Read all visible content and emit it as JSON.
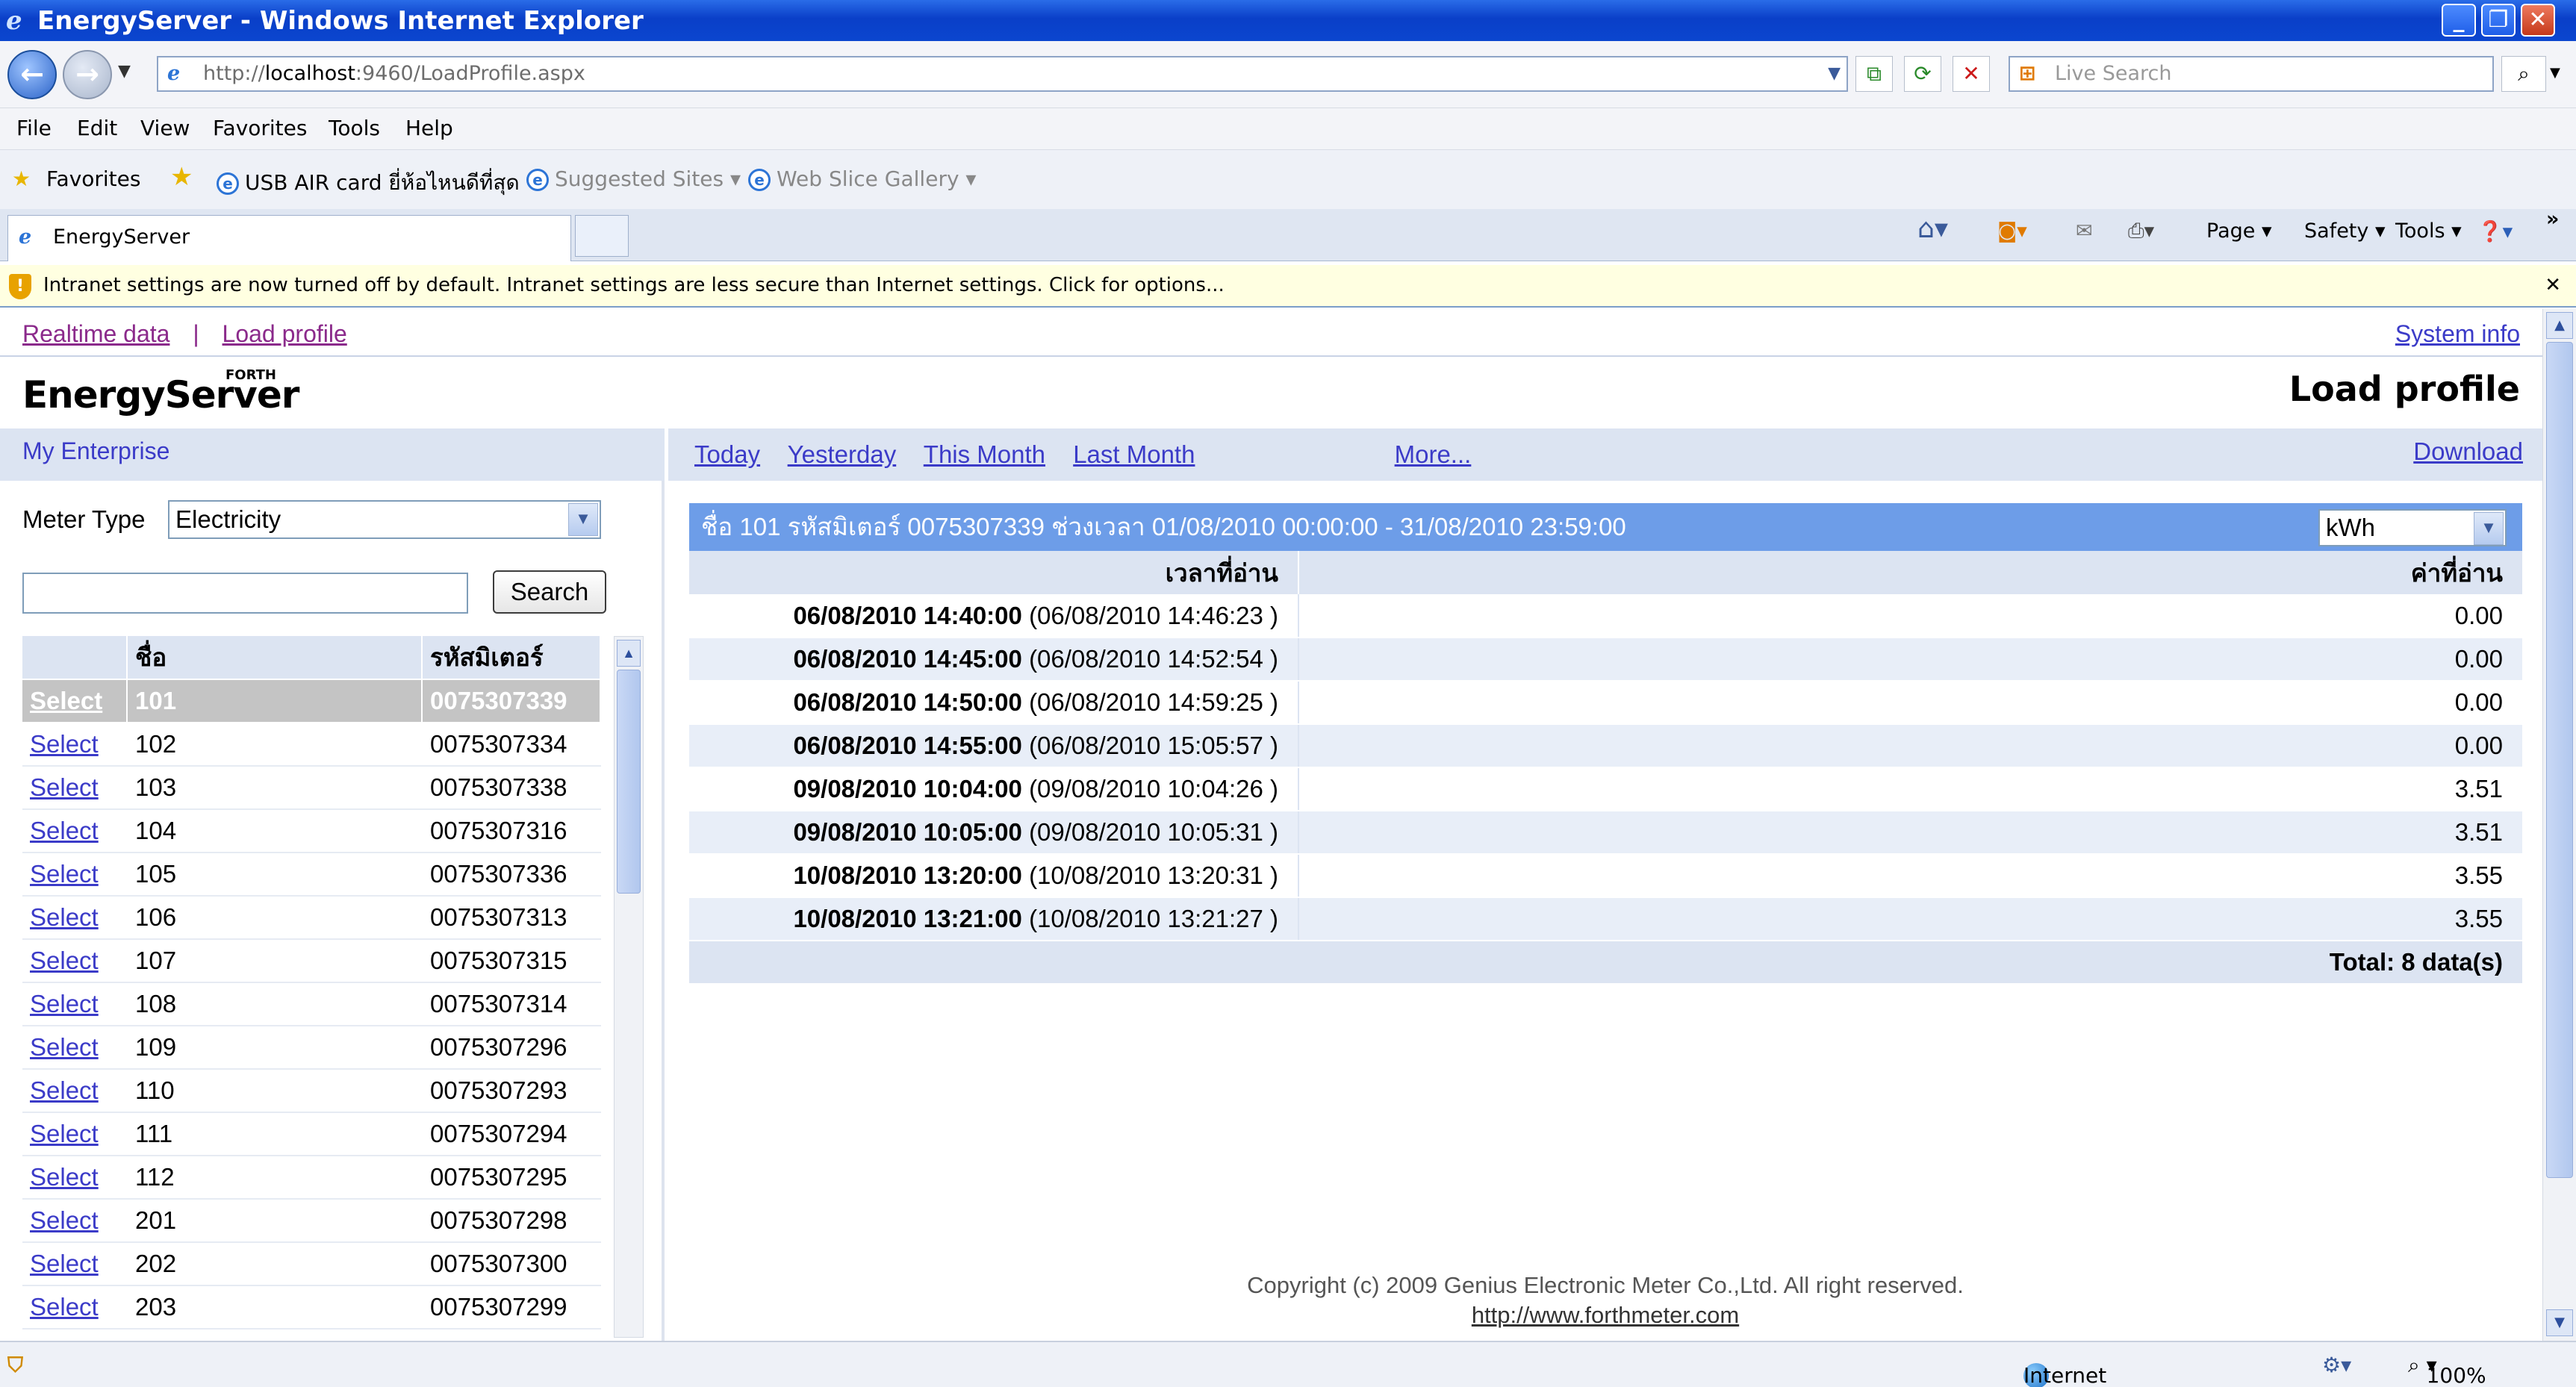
{
  "window": {
    "title": "EnergyServer - Windows Internet Explorer",
    "min": "_",
    "max": "❐",
    "close": "✕"
  },
  "address": {
    "prefix": "http://",
    "host": "localhost",
    "path": ":9460/LoadProfile.aspx",
    "search_placeholder": "Live Search"
  },
  "menu": [
    "File",
    "Edit",
    "View",
    "Favorites",
    "Tools",
    "Help"
  ],
  "favorites": {
    "label": "Favorites",
    "items": [
      "USB AIR card ยี่ห้อไหนดีที่สุด",
      "Suggested Sites ▾",
      "Web Slice Gallery ▾"
    ]
  },
  "tab": {
    "title": "EnergyServer"
  },
  "commands": [
    "Page ▾",
    "Safety ▾",
    "Tools ▾"
  ],
  "infobar": {
    "text": "Intranet settings are now turned off by default. Intranet settings are less secure than Internet settings. Click for options...",
    "close": "✕"
  },
  "nav": {
    "realtime": "Realtime data",
    "sep": "|",
    "load": "Load profile",
    "sysinfo": "System info"
  },
  "logo": {
    "main": "EnergyServer",
    "small": "FORTH"
  },
  "page_title": "Load profile",
  "left": {
    "enterprise": "My Enterprise",
    "meter_type_label": "Meter Type",
    "meter_type_value": "Electricity",
    "search_button": "Search",
    "table": {
      "headers": [
        "",
        "ชื่อ",
        "รหัสมิเตอร์"
      ],
      "select_label": "Select",
      "rows": [
        [
          "Select",
          "101",
          "0075307339"
        ],
        [
          "Select",
          "102",
          "0075307334"
        ],
        [
          "Select",
          "103",
          "0075307338"
        ],
        [
          "Select",
          "104",
          "0075307316"
        ],
        [
          "Select",
          "105",
          "0075307336"
        ],
        [
          "Select",
          "106",
          "0075307313"
        ],
        [
          "Select",
          "107",
          "0075307315"
        ],
        [
          "Select",
          "108",
          "0075307314"
        ],
        [
          "Select",
          "109",
          "0075307296"
        ],
        [
          "Select",
          "110",
          "0075307293"
        ],
        [
          "Select",
          "111",
          "0075307294"
        ],
        [
          "Select",
          "112",
          "0075307295"
        ],
        [
          "Select",
          "201",
          "0075307298"
        ],
        [
          "Select",
          "202",
          "0075307300"
        ],
        [
          "Select",
          "203",
          "0075307299"
        ]
      ]
    }
  },
  "right": {
    "quick_links": [
      "Today",
      "Yesterday",
      "This Month",
      "Last Month"
    ],
    "more": "More...",
    "download": "Download",
    "info_header": "ชื่อ 101   รหัสมิเตอร์ 0075307339   ช่วงเวลา 01/08/2010 00:00:00 - 31/08/2010 23:59:00",
    "unit": "kWh",
    "table": {
      "headers": [
        "เวลาที่อ่าน",
        "ค่าที่อ่าน"
      ],
      "rows": [
        {
          "time": "06/08/2010 14:40:00",
          "read": "(06/08/2010 14:46:23 )",
          "value": "0.00"
        },
        {
          "time": "06/08/2010 14:45:00",
          "read": "(06/08/2010 14:52:54 )",
          "value": "0.00"
        },
        {
          "time": "06/08/2010 14:50:00",
          "read": "(06/08/2010 14:59:25 )",
          "value": "0.00"
        },
        {
          "time": "06/08/2010 14:55:00",
          "read": "(06/08/2010 15:05:57 )",
          "value": "0.00"
        },
        {
          "time": "09/08/2010 10:04:00",
          "read": "(09/08/2010 10:04:26 )",
          "value": "3.51"
        },
        {
          "time": "09/08/2010 10:05:00",
          "read": "(09/08/2010 10:05:31 )",
          "value": "3.51"
        },
        {
          "time": "10/08/2010 13:20:00",
          "read": "(10/08/2010 13:20:31 )",
          "value": "3.55"
        },
        {
          "time": "10/08/2010 13:21:00",
          "read": "(10/08/2010 13:21:27 )",
          "value": "3.55"
        }
      ],
      "total": "Total: 8 data(s)"
    }
  },
  "footer": {
    "copyright": "Copyright (c) 2009 Genius Electronic Meter Co.,Ltd. All right reserved.",
    "link": "http://www.forthmeter.com"
  },
  "status": {
    "zone": "Internet",
    "zoom": "100%"
  }
}
